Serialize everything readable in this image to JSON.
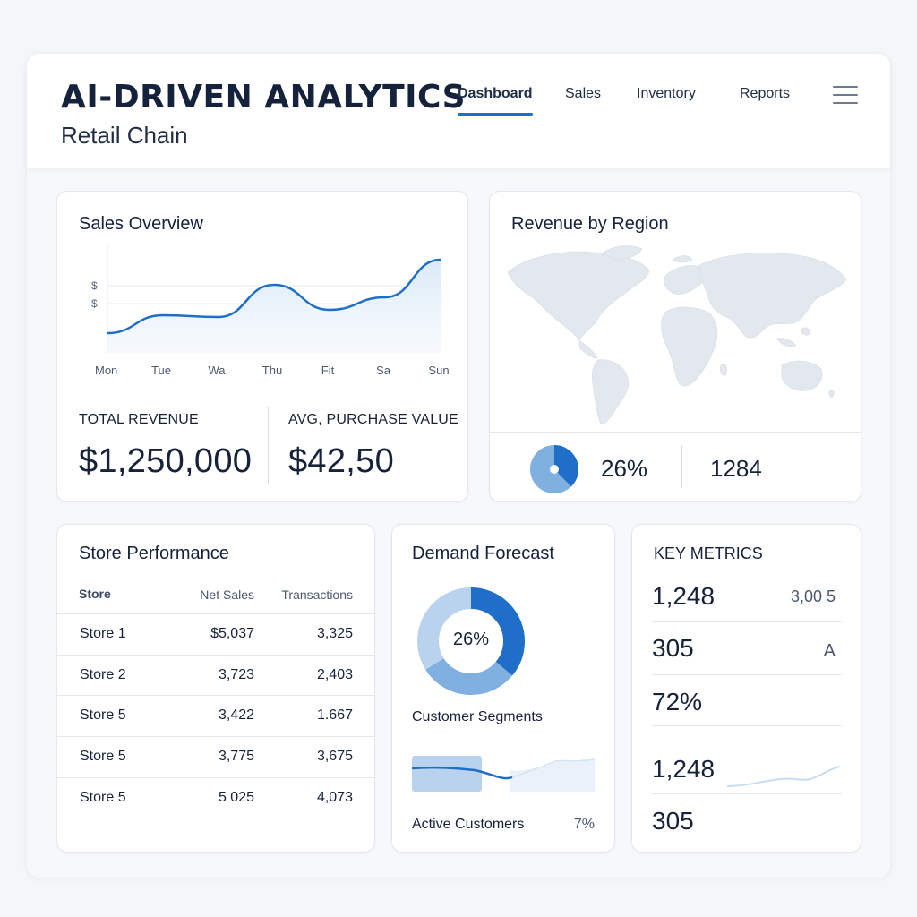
{
  "header": {
    "title": "AI-DRIVEN ANALYTICS",
    "subtitle": "Retail Chain",
    "nav": [
      {
        "label": "Dashboard",
        "active": true
      },
      {
        "label": "Sales",
        "active": false
      },
      {
        "label": "Inventory",
        "active": false
      },
      {
        "label": "Reports",
        "active": false
      }
    ]
  },
  "sales_overview": {
    "title": "Sales Overview",
    "total_revenue_label": "TOTAL REVENUE",
    "total_revenue_value": "$1,250,000",
    "avg_purchase_label": "AVG, PURCHASE VALUE",
    "avg_purchase_value": "$42,50"
  },
  "chart_data": {
    "type": "area",
    "title": "Sales Overview",
    "categories": [
      "Mon",
      "Tue",
      "Wa",
      "Thu",
      "Fit",
      "Sa",
      "Sun"
    ],
    "y_tick_labels": [
      "$",
      "$"
    ],
    "values": [
      1.1,
      2.1,
      2.0,
      3.8,
      2.4,
      3.1,
      5.2
    ],
    "ylim": [
      0,
      6
    ],
    "grid": true,
    "color": "#1f6fc8"
  },
  "revenue_region": {
    "title": "Revenue by Region",
    "percent": "26%",
    "count": "1284",
    "pie_share": 0.26
  },
  "store_performance": {
    "title": "Store Performance",
    "columns": [
      "Store",
      "Net Sales",
      "Transactions"
    ],
    "rows": [
      [
        "Store 1",
        "$5,037",
        "3,325"
      ],
      [
        "Store 2",
        "3,723",
        "2,403"
      ],
      [
        "Store 5",
        "3,422",
        "1.667"
      ],
      [
        "Store 5",
        "3,775",
        "3,675"
      ],
      [
        "Store 5",
        "5 025",
        "4,073"
      ]
    ]
  },
  "demand_forecast": {
    "title": "Demand Forecast",
    "donut_percent": "26%",
    "donut_share": 0.36,
    "segments_label": "Customer Segments",
    "active_label": "Active Customers",
    "active_value": "7%"
  },
  "key_metrics": {
    "title": "KEY METRICS",
    "m1": "1,248",
    "m1_aside": "3,00 5",
    "m2": "305",
    "m2_aside": "A",
    "m3": "72%",
    "m4": "1,248",
    "m5": "305"
  },
  "colors": {
    "accent": "#1f6fc8",
    "accent_light": "#7fb0e0",
    "accent_pale": "#b9d3ee",
    "map": "#e3e8ef"
  }
}
